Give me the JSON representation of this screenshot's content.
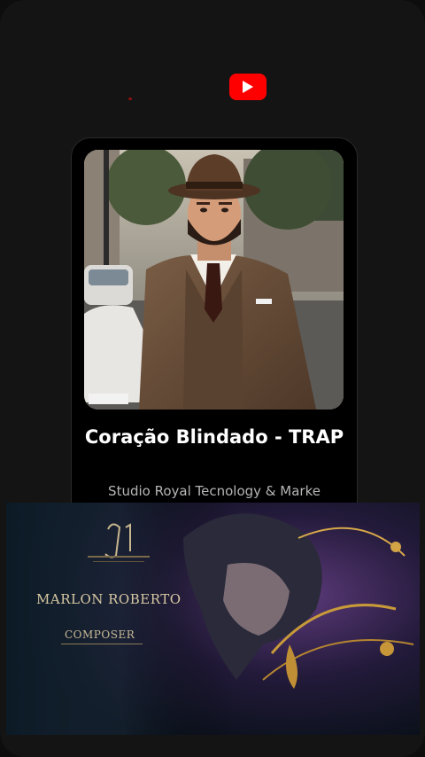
{
  "header": {
    "logo_icon": "youtube-play-icon",
    "brand_color": "#ff0000"
  },
  "track": {
    "title": "Coração Blindado - TRAP",
    "artist": "Studio Royal Tecnology & Marke",
    "cover_icon": "album-cover"
  },
  "banner": {
    "name": "MARLON ROBERTO",
    "subtitle": "COMPOSER",
    "tagline": "MARLON ROBERTO"
  }
}
